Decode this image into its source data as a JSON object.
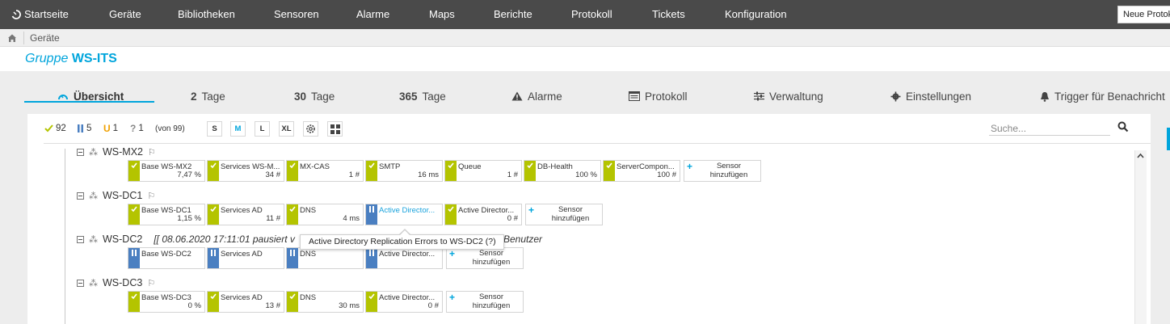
{
  "nav": {
    "home_label": "Startseite",
    "items": [
      "Geräte",
      "Bibliotheken",
      "Sensoren",
      "Alarme",
      "Maps",
      "Berichte",
      "Protokoll",
      "Tickets",
      "Konfiguration"
    ],
    "new_button": "Neue Protokol"
  },
  "breadcrumb": {
    "current": "Geräte"
  },
  "group": {
    "prefix": "Gruppe",
    "name": "WS-ITS"
  },
  "tabs": {
    "overview": "Übersicht",
    "two_days_num": "2",
    "two_days_label": "Tage",
    "thirty_days_num": "30",
    "thirty_days_label": "Tage",
    "year_num": "365",
    "year_label": "Tage",
    "alarms": "Alarme",
    "log": "Protokoll",
    "management": "Verwaltung",
    "settings": "Einstellungen",
    "triggers": "Trigger für Benachricht"
  },
  "toolbar": {
    "ok_count": "92",
    "paused_count": "5",
    "unusual_count": "1",
    "unknown_count": "1",
    "total": "(von 99)",
    "sizes": [
      "S",
      "M",
      "L",
      "XL"
    ],
    "search_placeholder": "Suche..."
  },
  "colors": {
    "accent": "#00a5dc",
    "ok": "#b4c400",
    "paused": "#4a7fc1",
    "unusual": "#f0a000",
    "nav_bg": "#4a4a4a"
  },
  "devices": [
    {
      "name": "WS-MX2",
      "sensors": [
        {
          "name": "Base WS-MX2",
          "value": "7,47 %"
        },
        {
          "name": "Services WS-M...",
          "value": "34 #"
        },
        {
          "name": "MX-CAS",
          "value": "1 #"
        },
        {
          "name": "SMTP",
          "value": "16 ms"
        },
        {
          "name": "Queue",
          "value": "1 #"
        },
        {
          "name": "DB-Health",
          "value": "100 %"
        },
        {
          "name": "ServerCompon...",
          "value": "100 #"
        }
      ]
    },
    {
      "name": "WS-DC1",
      "sensors": [
        {
          "name": "Base WS-DC1",
          "value": "1,15 %"
        },
        {
          "name": "Services AD",
          "value": "11 #"
        },
        {
          "name": "DNS",
          "value": "4 ms"
        },
        {
          "name": "Active Director...",
          "value": ""
        },
        {
          "name": "Active Director...",
          "value": "0 #"
        }
      ]
    },
    {
      "name": "WS-DC2",
      "pause_message": "[[ 08.06.2020 17:11:01 pausiert v",
      "pause_tail": "Benutzer",
      "sensors": [
        {
          "name": "Base WS-DC2"
        },
        {
          "name": "Services AD"
        },
        {
          "name": "DNS"
        },
        {
          "name": "Active Director..."
        }
      ]
    },
    {
      "name": "WS-DC3",
      "sensors": [
        {
          "name": "Base WS-DC3",
          "value": "0 %"
        },
        {
          "name": "Services AD",
          "value": "13 #"
        },
        {
          "name": "DNS",
          "value": "30 ms"
        },
        {
          "name": "Active Director...",
          "value": "0 #"
        }
      ]
    }
  ],
  "add_sensor_label": "Sensor hinzufügen",
  "tooltip": "Active Directory Replication Errors to WS-DC2 (?)"
}
